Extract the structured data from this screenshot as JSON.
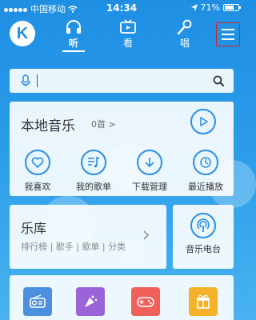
{
  "status_bar": {
    "carrier": "中国移动",
    "time": "14:34",
    "battery": "71%",
    "battery_level": 0.71
  },
  "nav": {
    "logo": "K",
    "tabs": [
      {
        "label": "听",
        "icon": "headphones-icon",
        "active": true
      },
      {
        "label": "看",
        "icon": "tv-icon",
        "active": false
      },
      {
        "label": "唱",
        "icon": "microphone-icon",
        "active": false
      }
    ],
    "menu_icon": "hamburger-menu-icon"
  },
  "search": {
    "placeholder": "",
    "value": ""
  },
  "local_music": {
    "title": "本地音乐",
    "count": "0首 >",
    "shortcuts": [
      {
        "label": "我喜欢",
        "icon": "heart-icon"
      },
      {
        "label": "我的歌单",
        "icon": "playlist-icon"
      },
      {
        "label": "下载管理",
        "icon": "download-icon"
      },
      {
        "label": "最近播放",
        "icon": "clock-icon"
      }
    ]
  },
  "library": {
    "title": "乐库",
    "subtitle": "排行榜 | 歌手 | 歌单 | 分类"
  },
  "radio": {
    "label": "音乐电台"
  },
  "bottom_tiles": [
    {
      "icon": "radio-icon",
      "color": "#4a8fe0"
    },
    {
      "icon": "cheer-icon",
      "color": "#9b63d8"
    },
    {
      "icon": "gamepad-icon",
      "color": "#f0605a"
    },
    {
      "icon": "gift-icon",
      "color": "#f4b12a"
    }
  ],
  "colors": {
    "accent": "#2b8fe0",
    "background": "#2a9ce9",
    "menu_highlight": "#d0242f"
  }
}
